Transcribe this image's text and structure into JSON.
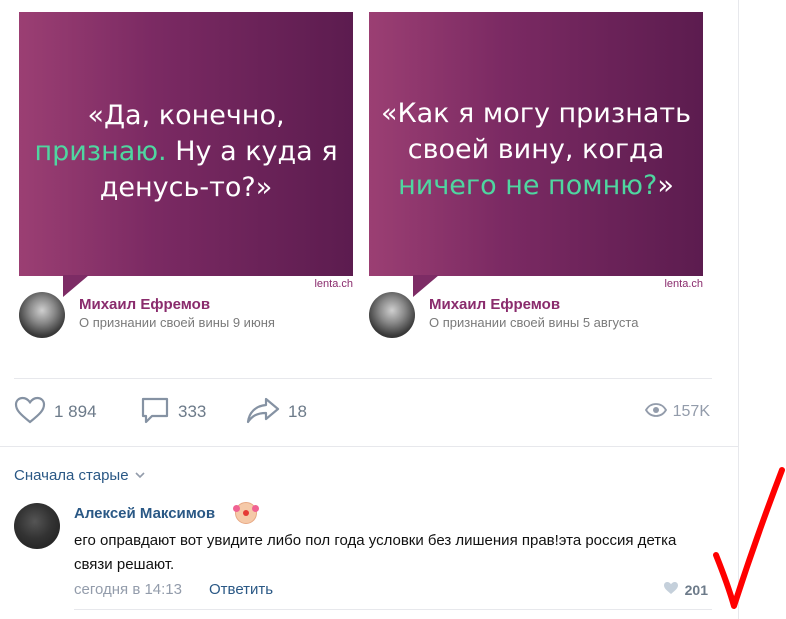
{
  "cards": [
    {
      "quote_pre": "«Да, конечно,",
      "quote_hl": "признаю.",
      "quote_post": " Ну а куда я денусь-то?»",
      "source": "lenta.ch",
      "person": "Михаил Ефремов",
      "subtitle": "О признании своей вины 9 июня"
    },
    {
      "quote_pre": "«Как я могу признать своей вину, когда",
      "quote_hl": "ничего не помню?",
      "quote_post": "»",
      "source": "lenta.ch",
      "person": "Михаил Ефремов",
      "subtitle": "О признании своей вины 5 августа"
    }
  ],
  "actions": {
    "likes": "1 894",
    "comments": "333",
    "shares": "18",
    "views": "157K"
  },
  "sort_label": "Сначала старые",
  "comment": {
    "author": "Алексей Максимов",
    "text": "его оправдают вот увидите либо пол года условки без лишения прав!эта россия детка связи решают.",
    "time": "сегодня в 14:13",
    "reply_label": "Ответить",
    "likes": "201"
  },
  "colors": {
    "banner_start": "#9b3f73",
    "banner_end": "#5c1c4f",
    "highlight": "#4fd6a0",
    "link": "#2a5885",
    "annotation": "#ff0000"
  },
  "icons": [
    "heart-icon",
    "comment-icon",
    "share-icon",
    "eye-icon",
    "chevron-down-icon",
    "clown-emoji-icon",
    "checkmark-annotation"
  ]
}
